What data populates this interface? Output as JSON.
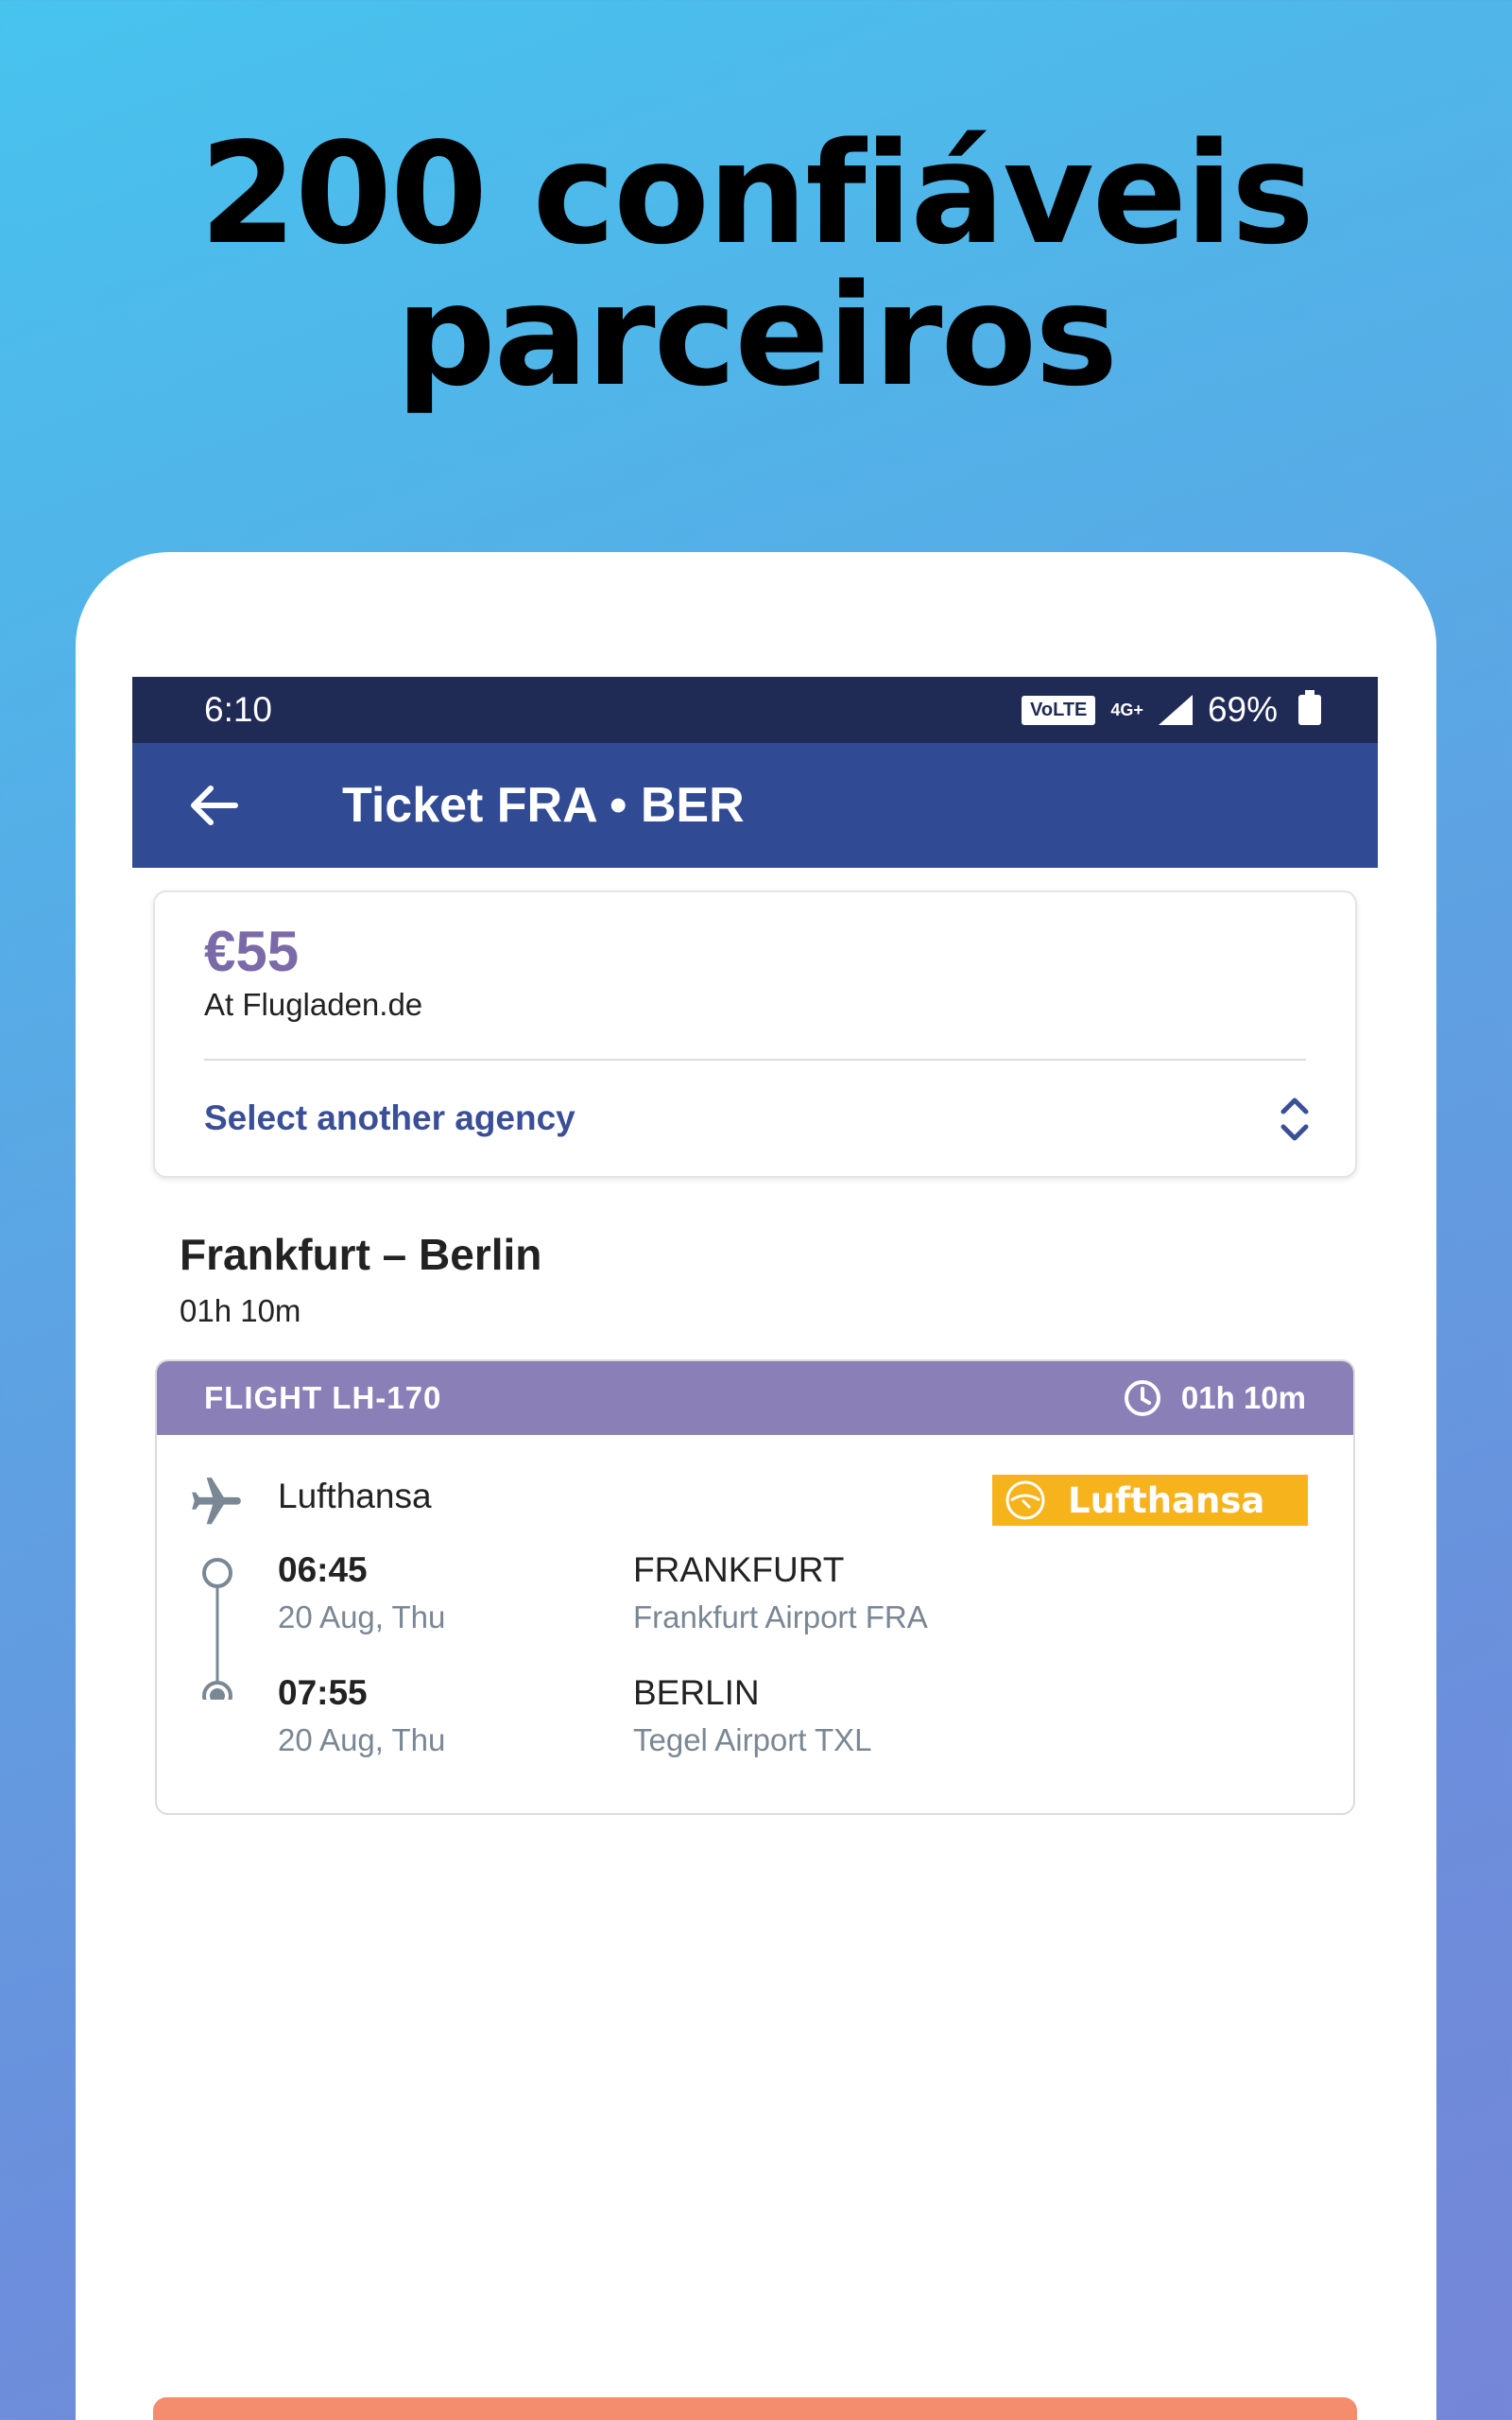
{
  "promo": {
    "line1": "200 confiáveis",
    "line2": "parceiros"
  },
  "status_bar": {
    "time": "6:10",
    "volte": "VoLTE",
    "network": "4G+",
    "battery": "69%"
  },
  "app_bar": {
    "title": "Ticket FRA • BER"
  },
  "offer": {
    "price": "€55",
    "agency": "At Flugladen.de",
    "select_agency": "Select another agency"
  },
  "route": {
    "title": "Frankfurt – Berlin",
    "duration": "01h 10m"
  },
  "flight": {
    "number": "FLIGHT LH-170",
    "duration": "01h 10m",
    "airline": "Lufthansa",
    "airline_logo_text": "Lufthansa",
    "departure": {
      "time": "06:45",
      "date": "20 Aug, Thu",
      "city": "FRANKFURT",
      "airport": "Frankfurt Airport FRA"
    },
    "arrival": {
      "time": "07:55",
      "date": "20 Aug, Thu",
      "city": "BERLIN",
      "airport": "Tegel Airport TXL"
    }
  },
  "colors": {
    "app_bar": "#304a94",
    "status_bar": "#1f2a55",
    "price": "#7b6aa8",
    "flight_header": "#8a80b7",
    "airline_logo": "#f6b31c",
    "cta": "#f48c6e"
  }
}
